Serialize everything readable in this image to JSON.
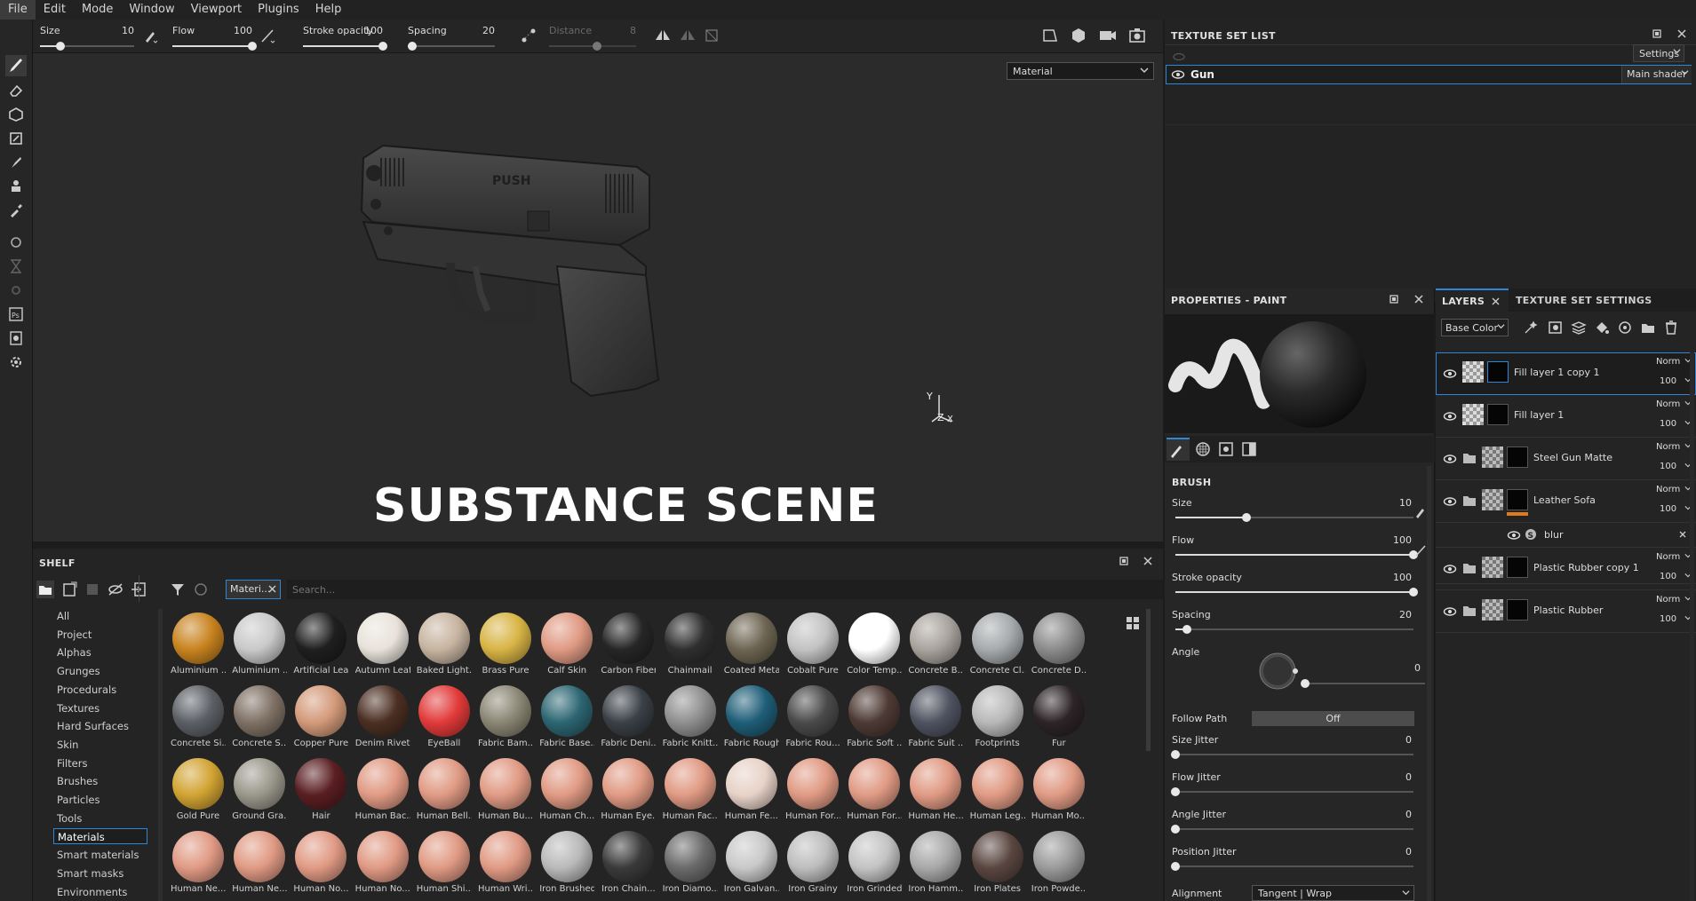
{
  "menu": [
    "File",
    "Edit",
    "Mode",
    "Window",
    "Viewport",
    "Plugins",
    "Help"
  ],
  "toolbar": {
    "size": {
      "label": "Size",
      "value": "10",
      "level": 0.22
    },
    "flow": {
      "label": "Flow",
      "value": "100",
      "level": 1.0
    },
    "stroke_opacity": {
      "label": "Stroke opacity",
      "value": "100",
      "level": 1.0
    },
    "spacing": {
      "label": "Spacing",
      "value": "20",
      "level": 0.05
    },
    "distance": {
      "label": "Distance",
      "value": "8",
      "level": 0.55
    }
  },
  "viewport": {
    "material_select": "Material",
    "model_text": "PUSH",
    "overlay_title": "SUBSTANCE SCENE",
    "axis_y": "Y",
    "axis_z": "Z",
    "axis_x": "X"
  },
  "shelf": {
    "title": "SHELF",
    "filter_chip": "Materi...",
    "search_placeholder": "Search...",
    "categories": [
      "All",
      "Project",
      "Alphas",
      "Grunges",
      "Procedurals",
      "Textures",
      "Hard Surfaces",
      "Skin",
      "Filters",
      "Brushes",
      "Particles",
      "Tools",
      "Materials",
      "Smart materials",
      "Smart masks",
      "Environments"
    ],
    "selected_category": "Materials",
    "materials": [
      {
        "name": "Aluminium ...",
        "color": "#c8831f"
      },
      {
        "name": "Aluminium ...",
        "color": "#c9c9c9"
      },
      {
        "name": "Artificial Lea...",
        "color": "#1f1f1f"
      },
      {
        "name": "Autumn Leaf",
        "color": "#e8e2da"
      },
      {
        "name": "Baked Light...",
        "color": "#c7b4a0"
      },
      {
        "name": "Brass Pure",
        "color": "#d8b445"
      },
      {
        "name": "Calf Skin",
        "color": "#e09a84"
      },
      {
        "name": "Carbon Fiber",
        "color": "#262626"
      },
      {
        "name": "Chainmail",
        "color": "#2f2f2f"
      },
      {
        "name": "Coated Metal",
        "color": "#6d6552"
      },
      {
        "name": "Cobalt Pure",
        "color": "#c2c2c2"
      },
      {
        "name": "Color Temp...",
        "color": "#ffffff"
      },
      {
        "name": "Concrete B...",
        "color": "#a9a39d"
      },
      {
        "name": "Concrete Cl...",
        "color": "#a6aaac"
      },
      {
        "name": "Concrete D...",
        "color": "#8b8b8b"
      },
      {
        "name": "Concrete Si...",
        "color": "#5c6066"
      },
      {
        "name": "Concrete S...",
        "color": "#7f7165"
      },
      {
        "name": "Copper Pure",
        "color": "#d39a7a"
      },
      {
        "name": "Denim Rivet",
        "color": "#4b2f22"
      },
      {
        "name": "EyeBall",
        "color": "#e23a3a"
      },
      {
        "name": "Fabric Bam...",
        "color": "#8a8674"
      },
      {
        "name": "Fabric Base...",
        "color": "#2c6672"
      },
      {
        "name": "Fabric Deni...",
        "color": "#3a4047"
      },
      {
        "name": "Fabric Knitt...",
        "color": "#8f8f8f"
      },
      {
        "name": "Fabric Rough",
        "color": "#1f5e78"
      },
      {
        "name": "Fabric Rou...",
        "color": "#4a4a4a"
      },
      {
        "name": "Fabric Soft ...",
        "color": "#4e3a34"
      },
      {
        "name": "Fabric Suit ...",
        "color": "#4f5360"
      },
      {
        "name": "Footprints",
        "color": "#b8b8b8"
      },
      {
        "name": "Fur",
        "color": "#2c2426"
      },
      {
        "name": "Gold Pure",
        "color": "#d1a332"
      },
      {
        "name": "Ground Gra...",
        "color": "#9a978b"
      },
      {
        "name": "Hair",
        "color": "#5a1e22"
      },
      {
        "name": "Human Bac...",
        "color": "#e09a84"
      },
      {
        "name": "Human Bell...",
        "color": "#e09a84"
      },
      {
        "name": "Human Bu...",
        "color": "#e09a84"
      },
      {
        "name": "Human Ch...",
        "color": "#e09a84"
      },
      {
        "name": "Human Eye...",
        "color": "#e09a84"
      },
      {
        "name": "Human Fac...",
        "color": "#e09a84"
      },
      {
        "name": "Human Fe...",
        "color": "#e7d2c7"
      },
      {
        "name": "Human For...",
        "color": "#e09a84"
      },
      {
        "name": "Human For...",
        "color": "#e09a84"
      },
      {
        "name": "Human He...",
        "color": "#e09a84"
      },
      {
        "name": "Human Leg...",
        "color": "#e09a84"
      },
      {
        "name": "Human Mo...",
        "color": "#e09a84"
      },
      {
        "name": "Human Ne...",
        "color": "#e09a84"
      },
      {
        "name": "Human Ne...",
        "color": "#e09a84"
      },
      {
        "name": "Human No...",
        "color": "#e09a84"
      },
      {
        "name": "Human No...",
        "color": "#e09a84"
      },
      {
        "name": "Human Shi...",
        "color": "#e09a84"
      },
      {
        "name": "Human Wri...",
        "color": "#e09a84"
      },
      {
        "name": "Iron Brushed",
        "color": "#b9b9b9"
      },
      {
        "name": "Iron Chain...",
        "color": "#3a3a3a"
      },
      {
        "name": "Iron Diamo...",
        "color": "#6a6a6a"
      },
      {
        "name": "Iron Galvan...",
        "color": "#c8c8c8"
      },
      {
        "name": "Iron Grainy",
        "color": "#bdbdbd"
      },
      {
        "name": "Iron Grinded",
        "color": "#c3c3c3"
      },
      {
        "name": "Iron Hamm...",
        "color": "#a8a8a8"
      },
      {
        "name": "Iron Plates",
        "color": "#5a4640"
      },
      {
        "name": "Iron Powde...",
        "color": "#9a9a9a"
      }
    ]
  },
  "texture_set_list": {
    "title": "TEXTURE SET LIST",
    "settings_label": "Settings",
    "set_name": "Gun",
    "shader": "Main shader"
  },
  "properties": {
    "title": "PROPERTIES - PAINT",
    "section": "BRUSH",
    "size": {
      "label": "Size",
      "value": "10",
      "level": 0.3
    },
    "flow": {
      "label": "Flow",
      "value": "100",
      "level": 1.0
    },
    "stroke_opacity": {
      "label": "Stroke opacity",
      "value": "100",
      "level": 1.0
    },
    "spacing": {
      "label": "Spacing",
      "value": "20",
      "level": 0.05
    },
    "angle": {
      "label": "Angle",
      "value": "0",
      "level": 0.0
    },
    "follow_path": {
      "label": "Follow Path",
      "value": "Off"
    },
    "size_jitter": {
      "label": "Size Jitter",
      "value": "0",
      "level": 0.0
    },
    "flow_jitter": {
      "label": "Flow Jitter",
      "value": "0",
      "level": 0.0
    },
    "angle_jitter": {
      "label": "Angle Jitter",
      "value": "0",
      "level": 0.0
    },
    "position_jitter": {
      "label": "Position Jitter",
      "value": "0",
      "level": 0.0
    },
    "alignment": {
      "label": "Alignment",
      "value": "Tangent | Wrap"
    }
  },
  "layers": {
    "tab_layers": "LAYERS",
    "tab_tss": "TEXTURE SET SETTINGS",
    "channel": "Base Color",
    "items": [
      {
        "name": "Fill layer 1 copy 1",
        "blend": "Norm",
        "opacity": "100",
        "type": "fill",
        "selected": true
      },
      {
        "name": "Fill layer 1",
        "blend": "Norm",
        "opacity": "100",
        "type": "fill",
        "selected": false
      },
      {
        "name": "Steel Gun Matte",
        "blend": "Norm",
        "opacity": "100",
        "type": "folder",
        "selected": false
      },
      {
        "name": "Leather Sofa",
        "blend": "Norm",
        "opacity": "100",
        "type": "folder",
        "selected": false
      },
      {
        "name": "Plastic Rubber copy 1",
        "blend": "Norm",
        "opacity": "100",
        "type": "folder",
        "selected": false
      },
      {
        "name": "Plastic Rubber",
        "blend": "Norm",
        "opacity": "100",
        "type": "folder",
        "selected": false
      }
    ],
    "effect": "blur"
  }
}
